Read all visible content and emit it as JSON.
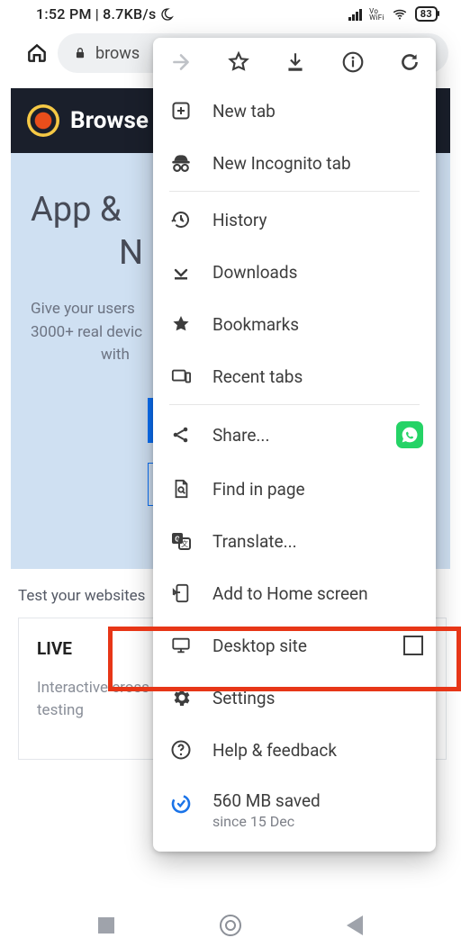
{
  "status": {
    "time": "1:52 PM",
    "net_rate": "8.7KB/s",
    "vo_top": "Vo",
    "vo_bot": "WiFi",
    "battery": "83"
  },
  "toolbar": {
    "url_text": "brows"
  },
  "page": {
    "brand": "Browse",
    "hero_title_l1": "App &",
    "hero_title_l2_visible": "N",
    "hero_sub_l1": "Give your users",
    "hero_sub_l2": "3000+ real devic",
    "hero_sub_l3": "with",
    "test_heading": "Test your websites",
    "card_title": "LIVE",
    "card_desc_l1": "Interactive cross br",
    "card_desc_l2": "testing"
  },
  "menu": {
    "new_tab": "New tab",
    "incognito": "New Incognito tab",
    "history": "History",
    "downloads": "Downloads",
    "bookmarks": "Bookmarks",
    "recent": "Recent tabs",
    "share": "Share...",
    "find": "Find in page",
    "translate": "Translate...",
    "a2hs": "Add to Home screen",
    "desktop": "Desktop site",
    "settings": "Settings",
    "help": "Help & feedback",
    "saved_l1": "560 MB saved",
    "saved_l2": "since 15 Dec"
  }
}
